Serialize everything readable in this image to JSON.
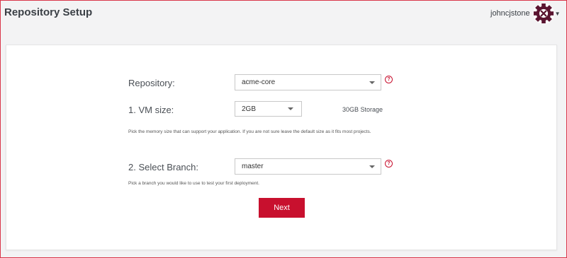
{
  "header": {
    "title": "Repository Setup",
    "username": "johncjstone",
    "avatar_icon": "gear-avatar-icon"
  },
  "form": {
    "repository": {
      "label": "Repository:",
      "selected": "acme-core",
      "help_icon": "question-circle-icon"
    },
    "vm_size": {
      "label": "1. VM size:",
      "selected": "2GB",
      "storage_text": "30GB Storage",
      "help_text": "Pick the memory size that can support your application. If you are not sure leave the default size as it fits most projects."
    },
    "branch": {
      "label": "2. Select Branch:",
      "selected": "master",
      "help_icon": "question-circle-icon",
      "help_text": "Pick a branch you would like to use to test your first deployment."
    },
    "next_label": "Next"
  },
  "colors": {
    "accent": "#c8102e",
    "frame_border": "#d9374a",
    "page_background": "#f3f3f4",
    "card_background": "#ffffff",
    "text": "#4a4f55",
    "avatar_fill": "#5a1430"
  }
}
